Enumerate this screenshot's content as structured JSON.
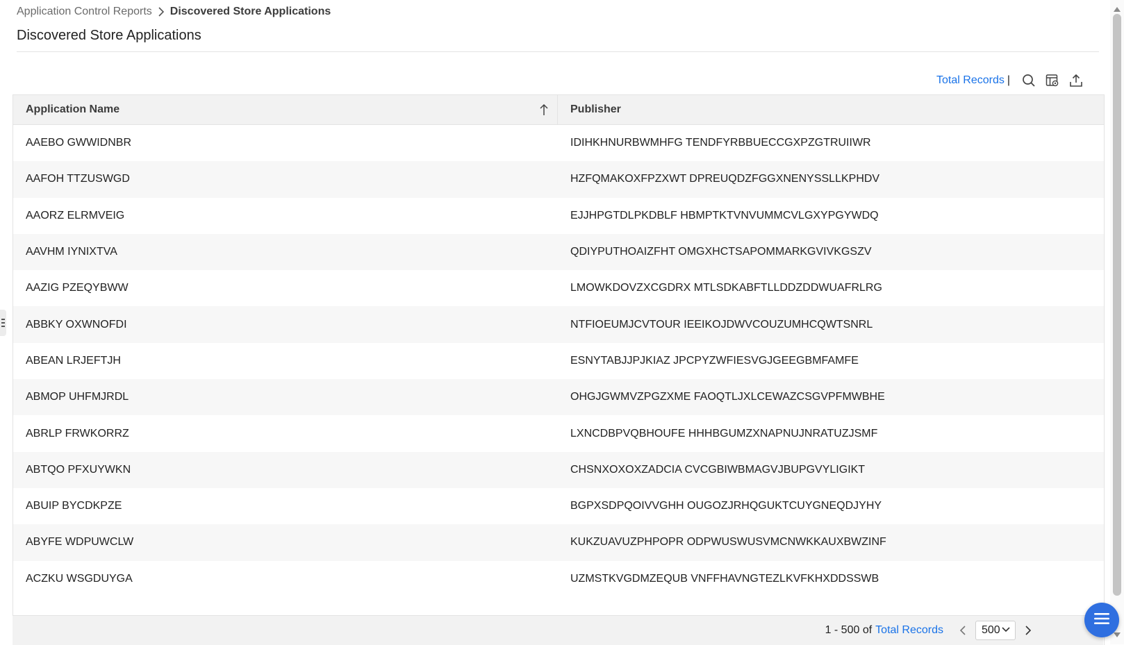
{
  "breadcrumb": {
    "parent": "Application Control Reports",
    "current": "Discovered Store Applications"
  },
  "page_title": "Discovered Store Applications",
  "toolbar": {
    "total_records_label": "Total Records",
    "separator": "|",
    "icons": [
      "search-icon",
      "column-settings-icon",
      "export-icon"
    ]
  },
  "table": {
    "columns": [
      {
        "label": "Application Name",
        "sort": "ascending"
      },
      {
        "label": "Publisher"
      }
    ],
    "rows": [
      {
        "app": "AAEBO GWWIDNBR",
        "publisher": "IDIHKHNURBWMHFG TENDFYRBBUECCGXPZGTRUIIWR"
      },
      {
        "app": "AAFOH TTZUSWGD",
        "publisher": "HZFQMAKOXFPZXWT DPREUQDZFGGXNENYSSLLKPHDV"
      },
      {
        "app": "AAORZ ELRMVEIG",
        "publisher": "EJJHPGTDLPKDBLF HBMPTKTVNVUMMCVLGXYPGYWDQ"
      },
      {
        "app": "AAVHM IYNIXTVA",
        "publisher": "QDIYPUTHOAIZFHT OMGXHCTSAPOMMARKGVIVKGSZV"
      },
      {
        "app": "AAZIG PZEQYBWW",
        "publisher": "LMOWKDOVZXCGDRX MTLSDKABFTLLDDZDDWUAFRLRG"
      },
      {
        "app": "ABBKY OXWNOFDI",
        "publisher": "NTFIOEUMJCVTOUR IEEIKOJDWVCOUZUMHCQWTSNRL"
      },
      {
        "app": "ABEAN LRJEFTJH",
        "publisher": "ESNYTABJJPJKIAZ JPCPYZWFIESVGJGEEGBMFAMFE"
      },
      {
        "app": "ABMOP UHFMJRDL",
        "publisher": "OHGJGWMVZPGZXME FAOQTLJXLCEWAZCSGVPFMWBHE"
      },
      {
        "app": "ABRLP FRWKORRZ",
        "publisher": "LXNCDBPVQBHOUFE HHHBGUMZXNAPNUJNRATUZJSMF"
      },
      {
        "app": "ABTQO PFXUYWKN",
        "publisher": "CHSNXOXOXZADCIA CVCGBIWBMAGVJBUPGVYLIGIKT"
      },
      {
        "app": "ABUIP BYCDKPZE",
        "publisher": "BGPXSDPQOIVVGHH OUGOZJRHQGUKTCUYGNEQDJYHY"
      },
      {
        "app": "ABYFE WDPUWCLW",
        "publisher": "KUKZUAVUZPHPOPR ODPWUSWUSVMCNWKKAUXBWZINF"
      },
      {
        "app": "ACZKU WSGDUYGA",
        "publisher": "UZMSTKVGDMZEQUB VNFFHAVNGTEZLKVFKHXDDSSWB"
      }
    ]
  },
  "footer": {
    "range": "1 - 500 of",
    "total_records_label": "Total Records",
    "page_size": "500"
  },
  "colors": {
    "link": "#1a73e8",
    "header_bg": "#f2f2f2",
    "fab": "#2f6fe0"
  }
}
